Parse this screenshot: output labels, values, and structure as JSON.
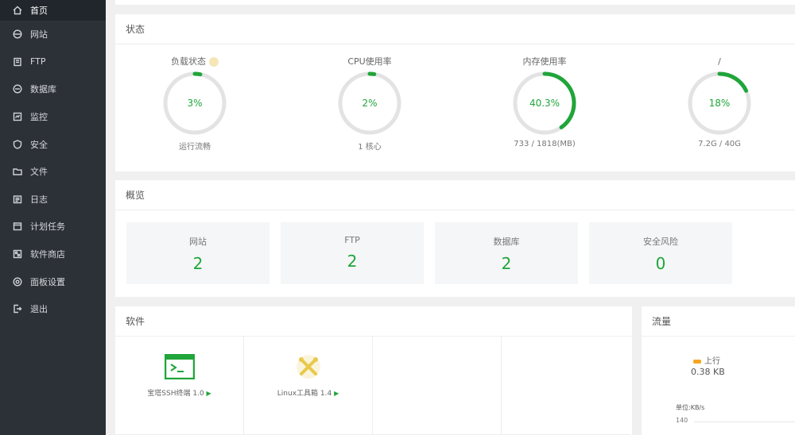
{
  "sidebar": {
    "items": [
      {
        "label": "首页",
        "icon": "home-icon"
      },
      {
        "label": "网站",
        "icon": "globe-icon"
      },
      {
        "label": "FTP",
        "icon": "ftp-icon"
      },
      {
        "label": "数据库",
        "icon": "database-icon"
      },
      {
        "label": "监控",
        "icon": "monitor-icon"
      },
      {
        "label": "安全",
        "icon": "shield-icon"
      },
      {
        "label": "文件",
        "icon": "folder-icon"
      },
      {
        "label": "日志",
        "icon": "log-icon"
      },
      {
        "label": "计划任务",
        "icon": "calendar-icon"
      },
      {
        "label": "软件商店",
        "icon": "store-icon"
      },
      {
        "label": "面板设置",
        "icon": "gear-icon"
      },
      {
        "label": "退出",
        "icon": "logout-icon"
      }
    ]
  },
  "status": {
    "title": "状态",
    "gauges": [
      {
        "title": "负载状态",
        "value": "3%",
        "percent": 3,
        "sub": "运行流畅"
      },
      {
        "title": "CPU使用率",
        "value": "2%",
        "percent": 2,
        "sub": "1 核心"
      },
      {
        "title": "内存使用率",
        "value": "40.3%",
        "percent": 40.3,
        "sub": "733 / 1818(MB)"
      },
      {
        "title": "/",
        "value": "18%",
        "percent": 18,
        "sub": "7.2G / 40G"
      }
    ]
  },
  "overview": {
    "title": "概览",
    "cards": [
      {
        "label": "网站",
        "value": "2"
      },
      {
        "label": "FTP",
        "value": "2"
      },
      {
        "label": "数据库",
        "value": "2"
      },
      {
        "label": "安全风险",
        "value": "0"
      }
    ]
  },
  "software": {
    "title": "软件",
    "items": [
      {
        "name": "宝塔SSH终端 1.0",
        "icon": "terminal-icon"
      },
      {
        "name": "Linux工具箱 1.4",
        "icon": "toolbox-icon"
      }
    ]
  },
  "traffic": {
    "title": "流量",
    "legend_up": "上行",
    "up_value": "0.38 KB",
    "unit_label": "单位:KB/s",
    "axis_tick": "140"
  },
  "colors": {
    "accent": "#20a53a",
    "sidebar_bg": "#2c3138",
    "upload": "#f5a623"
  }
}
